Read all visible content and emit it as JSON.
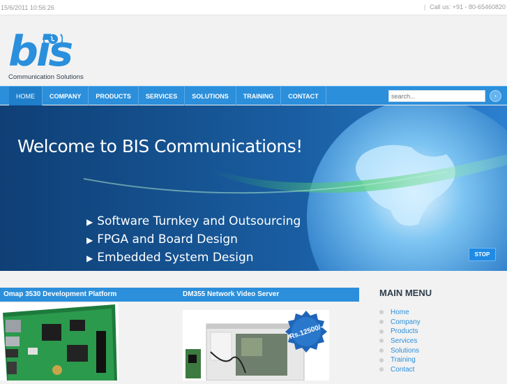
{
  "topbar": {
    "datetime": "15/6/2011 10:56:26",
    "call": "Call us: +91 - 80-65460820",
    "separator": "|"
  },
  "logo": {
    "text": "bis",
    "subtitle": "Communication Solutions"
  },
  "nav": {
    "items": [
      {
        "label": "HOME"
      },
      {
        "label": "COMPANY"
      },
      {
        "label": "PRODUCTS"
      },
      {
        "label": "SERVICES"
      },
      {
        "label": "SOLUTIONS"
      },
      {
        "label": "TRAINING"
      },
      {
        "label": "CONTACT"
      }
    ]
  },
  "search": {
    "placeholder": "search...",
    "button_icon": "arrow-right-icon"
  },
  "banner": {
    "headline": "Welcome to BIS Communications!",
    "bullets": [
      "Software Turnkey and Outsourcing",
      "FPGA and Board Design",
      "Embedded System Design"
    ],
    "stop_label": "STOP"
  },
  "products": {
    "item1_title": "Omap 3530 Development Platform",
    "item2_title": "DM355 Network Video Server",
    "item2_price": "Rs.12500/-"
  },
  "main_menu": {
    "title": "MAIN MENU",
    "items": [
      "Home",
      "Company",
      "Products",
      "Services",
      "Solutions",
      "Training",
      "Contact"
    ]
  },
  "colors": {
    "accent": "#2b8fdb",
    "banner": "#104b88",
    "text_dark": "#2f3d4c"
  }
}
